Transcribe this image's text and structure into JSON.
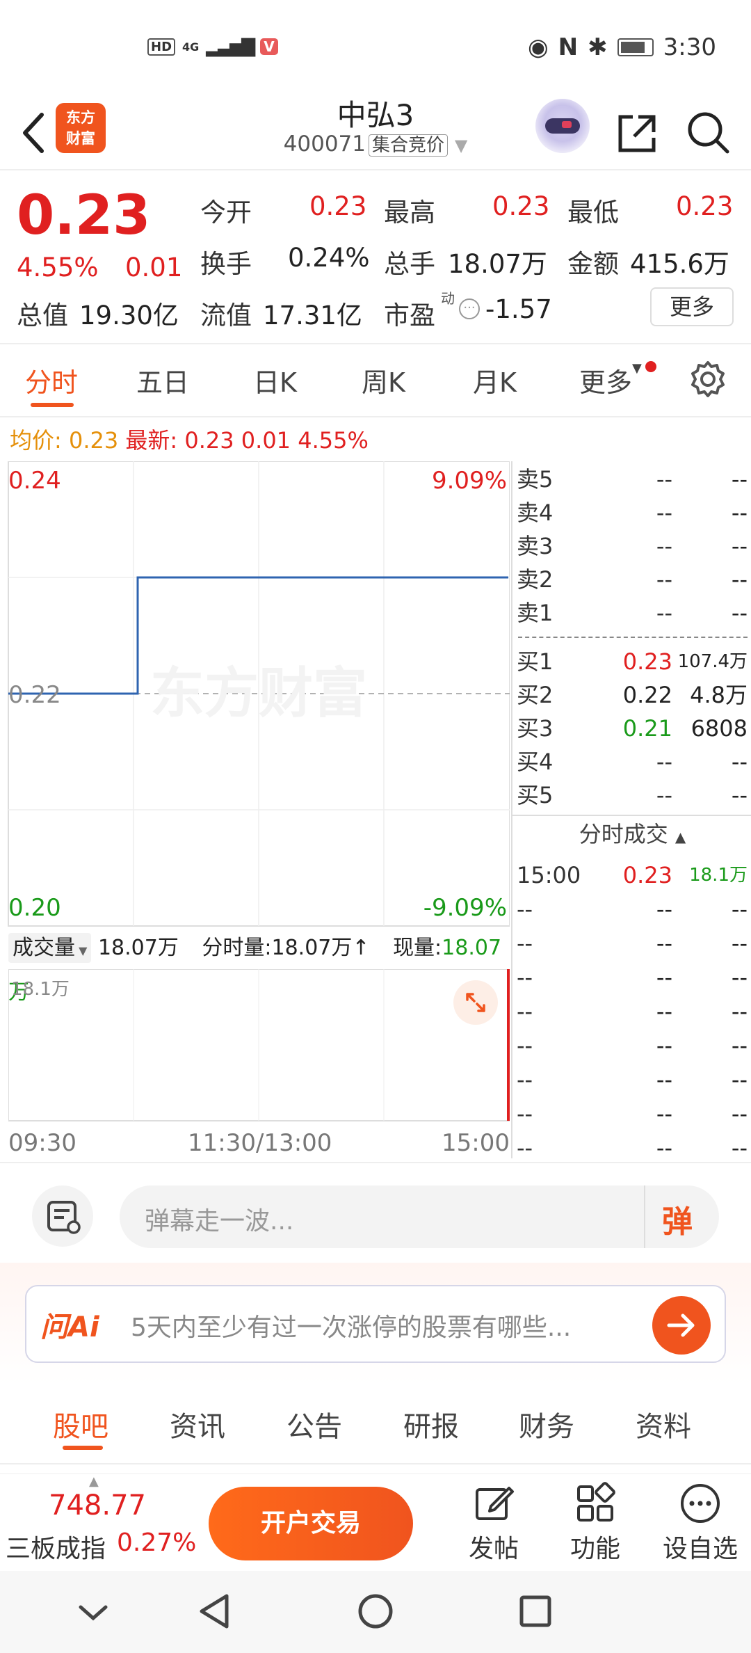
{
  "status": {
    "time": "3:30",
    "hd": "HD",
    "net": "4G",
    "v_badge": "V"
  },
  "header": {
    "name": "中弘3",
    "code": "400071",
    "tag": "集合竞价",
    "logo_line1": "东方",
    "logo_line2": "财富"
  },
  "quote": {
    "price": "0.23",
    "change_pct": "4.55%",
    "change": "0.01",
    "open_label": "今开",
    "open": "0.23",
    "high_label": "最高",
    "high": "0.23",
    "low_label": "最低",
    "low": "0.23",
    "turnover_label": "换手",
    "turnover": "0.24%",
    "volume_label": "总手",
    "volume": "18.07万",
    "amount_label": "金额",
    "amount": "415.6万",
    "mktcap_label": "总值",
    "mktcap": "19.30亿",
    "float_label": "流值",
    "float_cap": "17.31亿",
    "pe_label": "市盈",
    "pe_super": "动",
    "pe": "-1.57",
    "more": "更多"
  },
  "tabs": [
    "分时",
    "五日",
    "日K",
    "周K",
    "月K",
    "更多"
  ],
  "avgline": {
    "avg_label": "均价:",
    "avg": "0.23",
    "latest_label": "最新:",
    "latest": "0.23",
    "chg": "0.01",
    "pct": "4.55%"
  },
  "chart": {
    "top_price": "0.24",
    "top_pct": "9.09%",
    "mid_price": "0.22",
    "bottom_price": "0.20",
    "bottom_pct": "-9.09%",
    "watermark": "东方财富"
  },
  "chart_data": {
    "type": "line",
    "x": [
      "09:30",
      "09:30",
      "11:30/13:00",
      "15:00"
    ],
    "series": [
      {
        "values": [
          0.22,
          0.23,
          0.23,
          0.23
        ]
      }
    ],
    "ylim": [
      0.2,
      0.24
    ],
    "xlabel": "",
    "ylabel": "",
    "tick_labels_x": [
      "09:30",
      "11:30/13:00",
      "15:00"
    ]
  },
  "volume": {
    "label": "成交量",
    "value": "18.07万",
    "fs_label": "分时量:",
    "fs_value": "18.07万",
    "now_label": "现量:",
    "now_value": "18.07万",
    "max": "18.1万"
  },
  "time_axis": [
    "09:30",
    "11:30/13:00",
    "15:00"
  ],
  "orderbook": {
    "sells": [
      {
        "label": "卖5",
        "price": "--",
        "vol": "--"
      },
      {
        "label": "卖4",
        "price": "--",
        "vol": "--"
      },
      {
        "label": "卖3",
        "price": "--",
        "vol": "--"
      },
      {
        "label": "卖2",
        "price": "--",
        "vol": "--"
      },
      {
        "label": "卖1",
        "price": "--",
        "vol": "--"
      }
    ],
    "buys": [
      {
        "label": "买1",
        "price": "0.23",
        "vol": "107.4万"
      },
      {
        "label": "买2",
        "price": "0.22",
        "vol": "4.8万"
      },
      {
        "label": "买3",
        "price": "0.21",
        "vol": "6808"
      },
      {
        "label": "买4",
        "price": "--",
        "vol": "--"
      },
      {
        "label": "买5",
        "price": "--",
        "vol": "--"
      }
    ],
    "ticks_title": "分时成交",
    "ticks": [
      {
        "time": "15:00",
        "price": "0.23",
        "vol": "18.1万"
      },
      {
        "time": "--",
        "price": "--",
        "vol": "--"
      },
      {
        "time": "--",
        "price": "--",
        "vol": "--"
      },
      {
        "time": "--",
        "price": "--",
        "vol": "--"
      },
      {
        "time": "--",
        "price": "--",
        "vol": "--"
      },
      {
        "time": "--",
        "price": "--",
        "vol": "--"
      },
      {
        "time": "--",
        "price": "--",
        "vol": "--"
      },
      {
        "time": "--",
        "price": "--",
        "vol": "--"
      },
      {
        "time": "--",
        "price": "--",
        "vol": "--"
      }
    ]
  },
  "danmu": {
    "placeholder": "弹幕走一波...",
    "btn": "弹"
  },
  "ask": {
    "brand": "问Ai",
    "text": "5天内至少有过一次涨停的股票有哪些..."
  },
  "sections": [
    "股吧",
    "资讯",
    "公告",
    "研报",
    "财务",
    "资料"
  ],
  "bottom": {
    "index_value": "748.77",
    "index_name": "三板成指",
    "index_pct": "0.27%",
    "trade": "开户交易",
    "post": "发帖",
    "func": "功能",
    "watch": "设自选"
  },
  "colors": {
    "accent": "#f0541e",
    "up": "#e02020",
    "down": "#1a9a1a",
    "line": "#2f64b0"
  }
}
